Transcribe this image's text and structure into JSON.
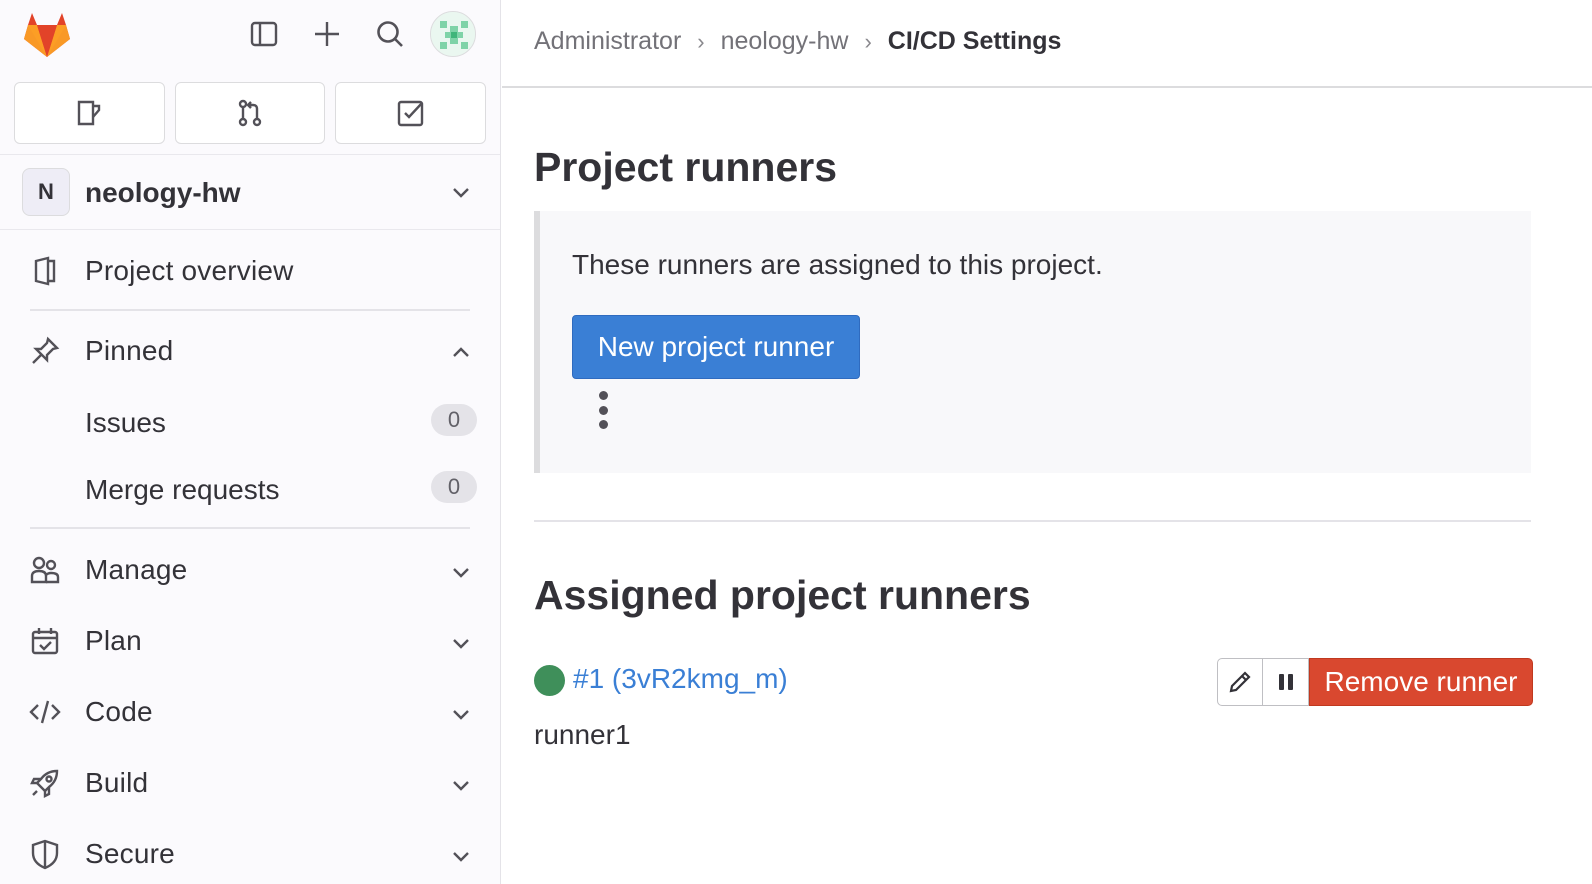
{
  "breadcrumb": {
    "items": [
      "Administrator",
      "neology-hw"
    ],
    "current": "CI/CD Settings",
    "separator": "›"
  },
  "sidebar": {
    "project": {
      "avatar_letter": "N",
      "name": "neology-hw"
    },
    "nav": {
      "overview": "Project overview",
      "pinned": "Pinned",
      "issues": {
        "label": "Issues",
        "count": "0"
      },
      "merge_requests": {
        "label": "Merge requests",
        "count": "0"
      },
      "manage": "Manage",
      "plan": "Plan",
      "code": "Code",
      "build": "Build",
      "secure": "Secure"
    }
  },
  "main": {
    "project_runners_title": "Project runners",
    "info_text": "These runners are assigned to this project.",
    "new_runner_button": "New project runner",
    "assigned_title": "Assigned project runners",
    "runner": {
      "link": "#1 (3vR2kmg_m)",
      "description": "runner1",
      "status": "online",
      "remove_button": "Remove runner"
    }
  },
  "colors": {
    "primary": "#3a7fd5",
    "danger": "#d9482f",
    "online": "#3f8f5a"
  }
}
